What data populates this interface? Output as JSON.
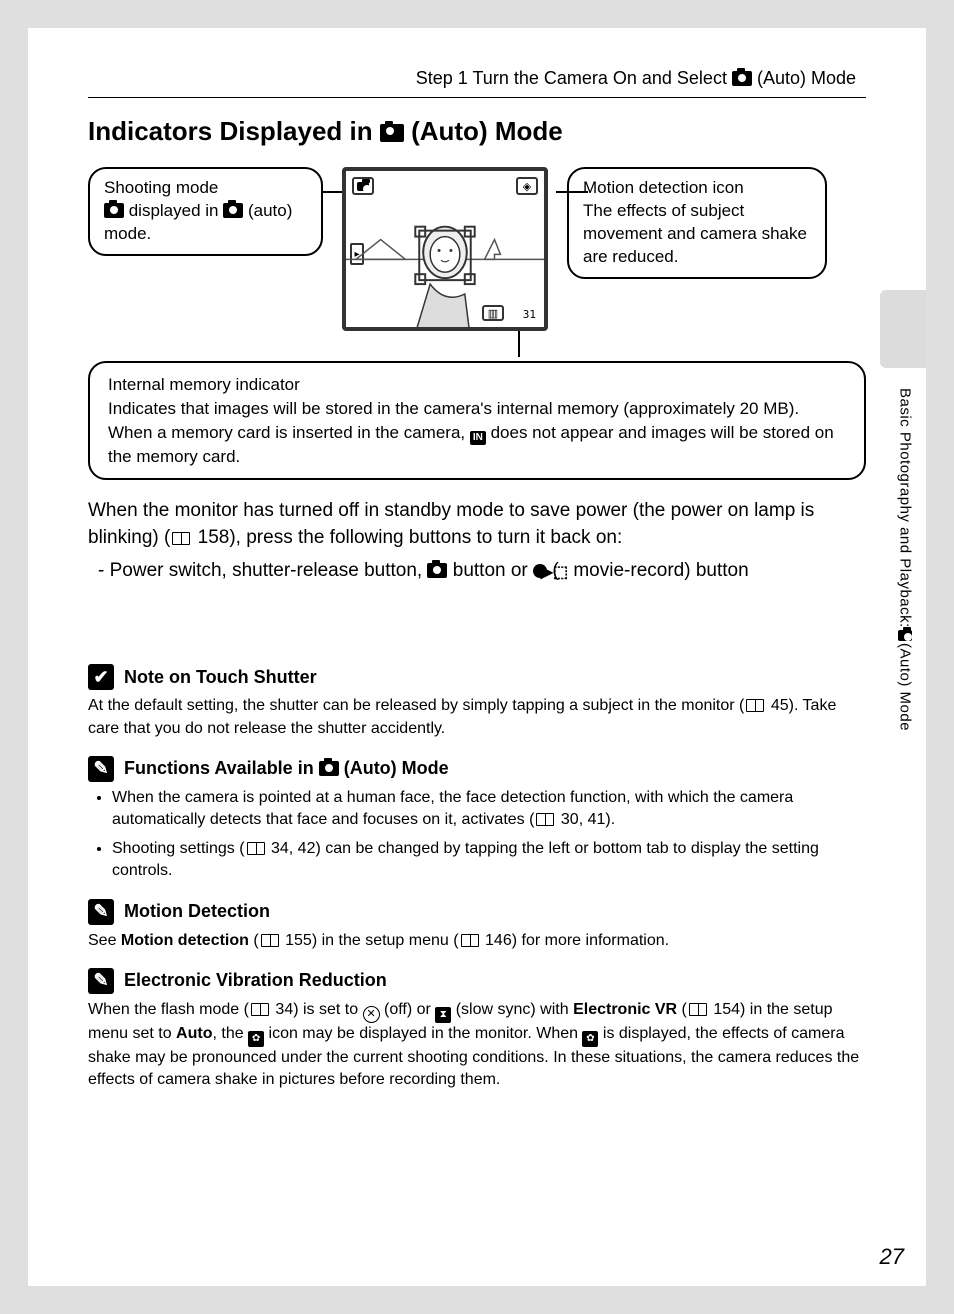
{
  "breadcrumb": {
    "prefix": "Step 1 Turn the Camera On and Select ",
    "suffix": " (Auto) Mode"
  },
  "heading": {
    "prefix": "Indicators Displayed in ",
    "suffix": " (Auto) Mode"
  },
  "callouts": {
    "shooting_mode": {
      "line1": "Shooting mode",
      "line2_pre": " displayed in ",
      "line2_post": " (auto) mode."
    },
    "motion_detection": {
      "line1": "Motion detection icon",
      "line2": "The effects of subject movement and camera shake are reduced."
    },
    "internal_memory": {
      "title": "Internal memory indicator",
      "p1": "Indicates that images will be stored in the camera's internal memory (approximately 20 MB).",
      "p2_pre": "When a memory card is inserted in the camera, ",
      "p2_post": " does not appear and images will be stored on the memory card."
    }
  },
  "lcd": {
    "count": "31"
  },
  "standby": {
    "p1_pre": "When the monitor has turned off in standby mode to save power (the power on lamp is blinking) (",
    "p1_ref": " 158), press the following buttons to turn it back on:",
    "item_pre": "-   Power switch, shutter-release button, ",
    "item_mid1": " button or ",
    "item_mid2": " (",
    "item_post": " movie-record) button"
  },
  "notes": {
    "touch": {
      "title": "Note on Touch Shutter",
      "body_pre": "At the default setting, the shutter can be released by simply tapping a subject in the monitor (",
      "body_post": " 45). Take care that you do not release the shutter accidently."
    },
    "functions": {
      "title_pre": "Functions Available in ",
      "title_post": " (Auto) Mode",
      "li1_pre": "When the camera is pointed at a human face, the face detection function, with which the camera automatically detects that face and focuses on it, activates (",
      "li1_post": " 30, 41).",
      "li2_pre": "Shooting settings (",
      "li2_post": " 34, 42) can be changed by tapping the left or bottom tab to display the setting controls."
    },
    "motion": {
      "title": "Motion Detection",
      "body_pre": "See ",
      "body_bold": "Motion detection",
      "body_mid": " (",
      "body_ref1": " 155) in the setup menu (",
      "body_ref2": " 146) for more information."
    },
    "evr": {
      "title": "Electronic Vibration Reduction",
      "p_pre": "When the flash mode (",
      "p_ref1": " 34) is set to ",
      "p_off": " (off) or ",
      "p_slow": " (slow sync) with ",
      "p_bold": "Electronic VR",
      "p_ref2_pre": " (",
      "p_ref2": " 154) in the setup menu set to ",
      "p_auto": "Auto",
      "p_mid": ", the ",
      "p_icon_post": " icon may be displayed in the monitor. When ",
      "p_tail": " is displayed, the effects of camera shake may be pronounced under the current shooting conditions. In these situations, the camera reduces the effects of camera shake in pictures before recording them."
    }
  },
  "side": {
    "line1": "Basic Photography and Playback: ",
    "line2": " (Auto) Mode"
  },
  "page_number": "27",
  "icons": {
    "check": "✔",
    "out": "✎",
    "in_label": "IN",
    "movie": "▶⬚",
    "flash_off": "✕",
    "slow": "⧗",
    "vr": "✿"
  }
}
